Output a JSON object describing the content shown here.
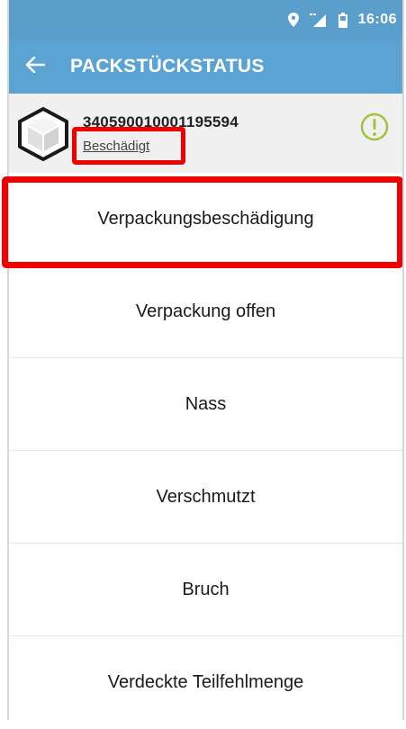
{
  "statusbar": {
    "icons": [
      "location-icon",
      "signal-icon",
      "battery-icon"
    ],
    "time": "16:06"
  },
  "toolbar": {
    "back_icon": "back-arrow-icon",
    "title": "PACKSTÜCKSTATUS"
  },
  "parcel": {
    "icon": "package-box-icon",
    "tracking_number": "340590010001195594",
    "status": "Beschädigt",
    "info_icon": "exclamation-circle-icon"
  },
  "options": [
    {
      "label": "Verpackungsbeschädigung"
    },
    {
      "label": "Verpackung offen"
    },
    {
      "label": "Nass"
    },
    {
      "label": "Verschmutzt"
    },
    {
      "label": "Bruch"
    },
    {
      "label": "Verdeckte Teilfehlmenge"
    }
  ],
  "colors": {
    "toolbar": "#5aa3d3",
    "statusbar": "#5a9fcb",
    "highlight": "#f00000",
    "info_icon": "#9bc53d",
    "header_background": "#f0f0f0"
  }
}
